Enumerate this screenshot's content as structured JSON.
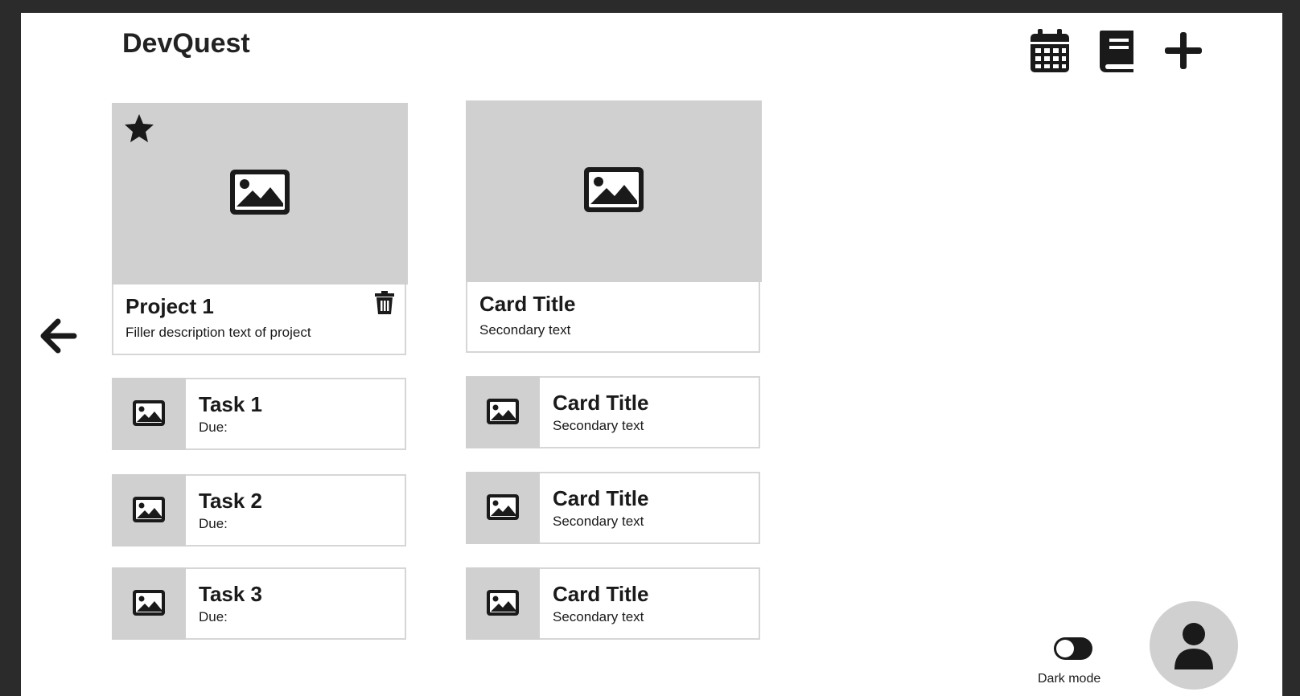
{
  "app": {
    "title": "DevQuest"
  },
  "toolbar": {
    "icons": [
      "calendar-icon",
      "book-icon",
      "plus-icon"
    ]
  },
  "navigation": {
    "back_icon": "arrow-left-icon"
  },
  "left_column": {
    "featured": {
      "title": "Project 1",
      "description": "Filler description text of project",
      "starred": true
    },
    "tasks": [
      {
        "title": "Task 1",
        "due": "Due:"
      },
      {
        "title": "Task 2",
        "due": "Due:"
      },
      {
        "title": "Task 3",
        "due": "Due:"
      }
    ]
  },
  "right_column": {
    "featured": {
      "title": "Card Title",
      "secondary": "Secondary text"
    },
    "cards": [
      {
        "title": "Card Title",
        "secondary": "Secondary text"
      },
      {
        "title": "Card Title",
        "secondary": "Secondary text"
      },
      {
        "title": "Card Title",
        "secondary": "Secondary text"
      }
    ]
  },
  "footer": {
    "dark_mode_label": "Dark mode",
    "dark_mode_on": false
  },
  "colors": {
    "placeholder": "#d0d0d0",
    "icon": "#1a1a1a",
    "card_border": "#d6d6d6",
    "page_background": "#2b2b2b"
  }
}
